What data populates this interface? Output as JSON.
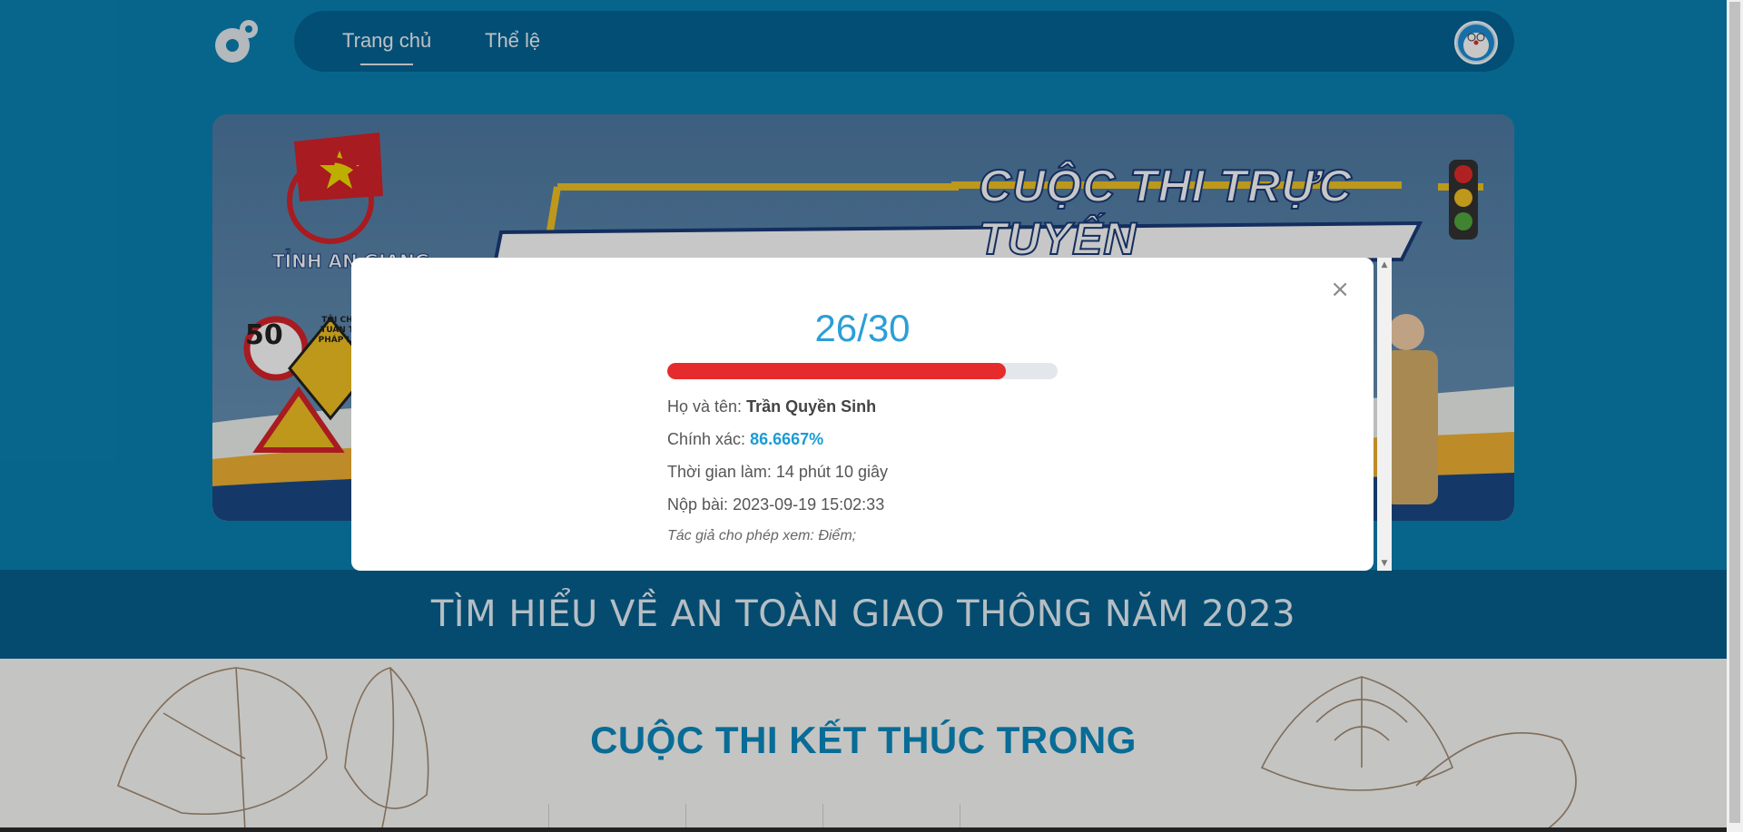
{
  "nav": {
    "items": [
      {
        "label": "Trang chủ",
        "active": true
      },
      {
        "label": "Thể lệ",
        "active": false
      }
    ]
  },
  "banner": {
    "title": "CUỘC THI TRỰC TUYẾN",
    "province": "TỈNH AN GIANG",
    "speed_limit": "50",
    "sign_text": "TÔI CHỌN TUÂN THỦ PHÁP LUẬT"
  },
  "contest_title": "TÌM HIỂU VỀ AN TOÀN GIAO THÔNG NĂM 2023",
  "section_heading": "CUỘC THI KẾT THÚC TRONG",
  "result": {
    "score": "26/30",
    "progress_fraction": 0.8667,
    "name_label": "Họ và tên:",
    "name_value": "Trần Quyền Sinh",
    "accuracy_label": "Chính xác:",
    "accuracy_value": "86.6667%",
    "time_label": "Thời gian làm:",
    "time_value": "14 phút 10 giây",
    "submit_label": "Nộp bài:",
    "submit_value": "2023-09-19 15:02:33",
    "note": "Tác giả cho phép xem: Điểm;",
    "close_glyph": "×"
  },
  "colors": {
    "primary": "#0a82b4",
    "nav": "#056496",
    "accent": "#2b9fd6",
    "progress": "#e52b2b"
  },
  "icons": [
    "app-logo-icon",
    "avatar-icon",
    "close-icon"
  ]
}
